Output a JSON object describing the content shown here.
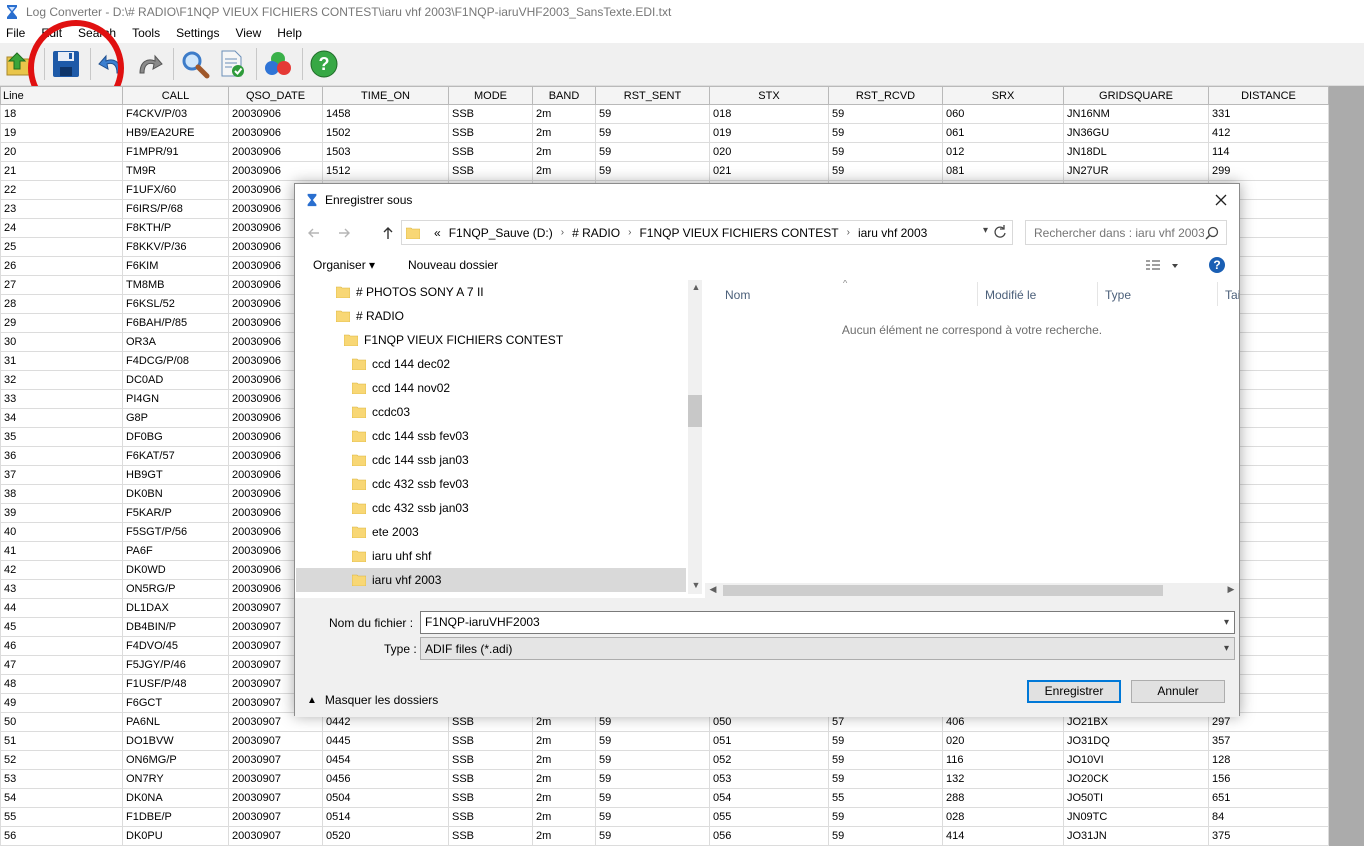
{
  "window": {
    "title": "Log Converter - D:\\# RADIO\\F1NQP VIEUX FICHIERS CONTEST\\iaru vhf 2003\\F1NQP-iaruVHF2003_SansTexte.EDI.txt"
  },
  "menu": [
    "File",
    "Edit",
    "Search",
    "Tools",
    "Settings",
    "View",
    "Help"
  ],
  "grid": {
    "columns": [
      "Line",
      "CALL",
      "QSO_DATE",
      "TIME_ON",
      "MODE",
      "BAND",
      "RST_SENT",
      "STX",
      "RST_RCVD",
      "SRX",
      "GRIDSQUARE",
      "DISTANCE"
    ],
    "rows": [
      [
        "18",
        "F4CKV/P/03",
        "20030906",
        "1458",
        "SSB",
        "2m",
        "59",
        "018",
        "59",
        "060",
        "JN16NM",
        "331"
      ],
      [
        "19",
        "HB9/EA2URE",
        "20030906",
        "1502",
        "SSB",
        "2m",
        "59",
        "019",
        "59",
        "061",
        "JN36GU",
        "412"
      ],
      [
        "20",
        "F1MPR/91",
        "20030906",
        "1503",
        "SSB",
        "2m",
        "59",
        "020",
        "59",
        "012",
        "JN18DL",
        "114"
      ],
      [
        "21",
        "TM9R",
        "20030906",
        "1512",
        "SSB",
        "2m",
        "59",
        "021",
        "59",
        "081",
        "JN27UR",
        "299"
      ],
      [
        "22",
        "F1UFX/60",
        "20030906",
        "",
        "",
        "",
        "",
        "",
        "",
        "",
        "",
        ""
      ],
      [
        "23",
        "F6IRS/P/68",
        "20030906",
        "",
        "",
        "",
        "",
        "",
        "",
        "",
        "",
        ""
      ],
      [
        "24",
        "F8KTH/P",
        "20030906",
        "",
        "",
        "",
        "",
        "",
        "",
        "",
        "",
        ""
      ],
      [
        "25",
        "F8KKV/P/36",
        "20030906",
        "",
        "",
        "",
        "",
        "",
        "",
        "",
        "",
        ""
      ],
      [
        "26",
        "F6KIM",
        "20030906",
        "",
        "",
        "",
        "",
        "",
        "",
        "",
        "",
        ""
      ],
      [
        "27",
        "TM8MB",
        "20030906",
        "",
        "",
        "",
        "",
        "",
        "",
        "",
        "",
        ""
      ],
      [
        "28",
        "F6KSL/52",
        "20030906",
        "",
        "",
        "",
        "",
        "",
        "",
        "",
        "",
        ""
      ],
      [
        "29",
        "F6BAH/P/85",
        "20030906",
        "",
        "",
        "",
        "",
        "",
        "",
        "",
        "",
        ""
      ],
      [
        "30",
        "OR3A",
        "20030906",
        "",
        "",
        "",
        "",
        "",
        "",
        "",
        "",
        ""
      ],
      [
        "31",
        "F4DCG/P/08",
        "20030906",
        "",
        "",
        "",
        "",
        "",
        "",
        "",
        "",
        ""
      ],
      [
        "32",
        "DC0AD",
        "20030906",
        "",
        "",
        "",
        "",
        "",
        "",
        "",
        "",
        ""
      ],
      [
        "33",
        "PI4GN",
        "20030906",
        "",
        "",
        "",
        "",
        "",
        "",
        "",
        "",
        ""
      ],
      [
        "34",
        "G8P",
        "20030906",
        "",
        "",
        "",
        "",
        "",
        "",
        "",
        "",
        ""
      ],
      [
        "35",
        "DF0BG",
        "20030906",
        "",
        "",
        "",
        "",
        "",
        "",
        "",
        "",
        ""
      ],
      [
        "36",
        "F6KAT/57",
        "20030906",
        "",
        "",
        "",
        "",
        "",
        "",
        "",
        "",
        ""
      ],
      [
        "37",
        "HB9GT",
        "20030906",
        "",
        "",
        "",
        "",
        "",
        "",
        "",
        "",
        ""
      ],
      [
        "38",
        "DK0BN",
        "20030906",
        "",
        "",
        "",
        "",
        "",
        "",
        "",
        "",
        ""
      ],
      [
        "39",
        "F5KAR/P",
        "20030906",
        "",
        "",
        "",
        "",
        "",
        "",
        "",
        "",
        ""
      ],
      [
        "40",
        "F5SGT/P/56",
        "20030906",
        "",
        "",
        "",
        "",
        "",
        "",
        "",
        "",
        ""
      ],
      [
        "41",
        "PA6F",
        "20030906",
        "",
        "",
        "",
        "",
        "",
        "",
        "",
        "",
        ""
      ],
      [
        "42",
        "DK0WD",
        "20030906",
        "",
        "",
        "",
        "",
        "",
        "",
        "",
        "",
        ""
      ],
      [
        "43",
        "ON5RG/P",
        "20030906",
        "",
        "",
        "",
        "",
        "",
        "",
        "",
        "",
        ""
      ],
      [
        "44",
        "DL1DAX",
        "20030907",
        "",
        "",
        "",
        "",
        "",
        "",
        "",
        "",
        ""
      ],
      [
        "45",
        "DB4BIN/P",
        "20030907",
        "",
        "",
        "",
        "",
        "",
        "",
        "",
        "",
        ""
      ],
      [
        "46",
        "F4DVO/45",
        "20030907",
        "",
        "",
        "",
        "",
        "",
        "",
        "",
        "",
        ""
      ],
      [
        "47",
        "F5JGY/P/46",
        "20030907",
        "",
        "",
        "",
        "",
        "",
        "",
        "",
        "",
        ""
      ],
      [
        "48",
        "F1USF/P/48",
        "20030907",
        "",
        "",
        "",
        "",
        "",
        "",
        "",
        "",
        ""
      ],
      [
        "49",
        "F6GCT",
        "20030907",
        "",
        "",
        "",
        "",
        "",
        "",
        "",
        "",
        ""
      ],
      [
        "50",
        "PA6NL",
        "20030907",
        "0442",
        "SSB",
        "2m",
        "59",
        "050",
        "57",
        "406",
        "JO21BX",
        "297"
      ],
      [
        "51",
        "DO1BVW",
        "20030907",
        "0445",
        "SSB",
        "2m",
        "59",
        "051",
        "59",
        "020",
        "JO31DQ",
        "357"
      ],
      [
        "52",
        "ON6MG/P",
        "20030907",
        "0454",
        "SSB",
        "2m",
        "59",
        "052",
        "59",
        "116",
        "JO10VI",
        "128"
      ],
      [
        "53",
        "ON7RY",
        "20030907",
        "0456",
        "SSB",
        "2m",
        "59",
        "053",
        "59",
        "132",
        "JO20CK",
        "156"
      ],
      [
        "54",
        "DK0NA",
        "20030907",
        "0504",
        "SSB",
        "2m",
        "59",
        "054",
        "55",
        "288",
        "JO50TI",
        "651"
      ],
      [
        "55",
        "F1DBE/P",
        "20030907",
        "0514",
        "SSB",
        "2m",
        "59",
        "055",
        "59",
        "028",
        "JN09TC",
        "84"
      ],
      [
        "56",
        "DK0PU",
        "20030907",
        "0520",
        "SSB",
        "2m",
        "59",
        "056",
        "59",
        "414",
        "JO31JN",
        "375"
      ]
    ]
  },
  "dialog": {
    "title": "Enregistrer sous",
    "breadcrumb": {
      "prefix": "«",
      "items": [
        "F1NQP_Sauve (D:)",
        "# RADIO",
        "F1NQP VIEUX FICHIERS CONTEST",
        "iaru vhf 2003"
      ]
    },
    "search_placeholder": "Rechercher dans : iaru vhf 2003",
    "organize_label": "Organiser ▾",
    "new_folder_label": "Nouveau dossier",
    "tree": [
      {
        "label": "# PHOTOS SONY A 7 II",
        "level": 0
      },
      {
        "label": "# RADIO",
        "level": 0
      },
      {
        "label": "F1NQP VIEUX FICHIERS CONTEST",
        "level": 1
      },
      {
        "label": "ccd 144 dec02",
        "level": 2
      },
      {
        "label": "ccd 144 nov02",
        "level": 2
      },
      {
        "label": "ccdc03",
        "level": 2
      },
      {
        "label": "cdc 144 ssb fev03",
        "level": 2
      },
      {
        "label": "cdc 144 ssb jan03",
        "level": 2
      },
      {
        "label": "cdc 432 ssb fev03",
        "level": 2
      },
      {
        "label": "cdc 432 ssb jan03",
        "level": 2
      },
      {
        "label": "ete 2003",
        "level": 2
      },
      {
        "label": "iaru uhf shf",
        "level": 2
      },
      {
        "label": "iaru vhf 2003",
        "level": 2,
        "selected": true
      }
    ],
    "columns": {
      "name": "Nom",
      "modified": "Modifié le",
      "type": "Type",
      "size": "Tai"
    },
    "empty_message": "Aucun élément ne correspond à votre recherche.",
    "filename_label": "Nom du fichier :",
    "filename_value": "F1NQP-iaruVHF2003",
    "type_label": "Type :",
    "type_value": "ADIF files (*.adi)",
    "hide_folders_label": "Masquer les dossiers",
    "save_label": "Enregistrer",
    "cancel_label": "Annuler"
  },
  "colors": {
    "highlight": "#e01010",
    "accent": "#0078d7",
    "folder": "#f8d775"
  }
}
